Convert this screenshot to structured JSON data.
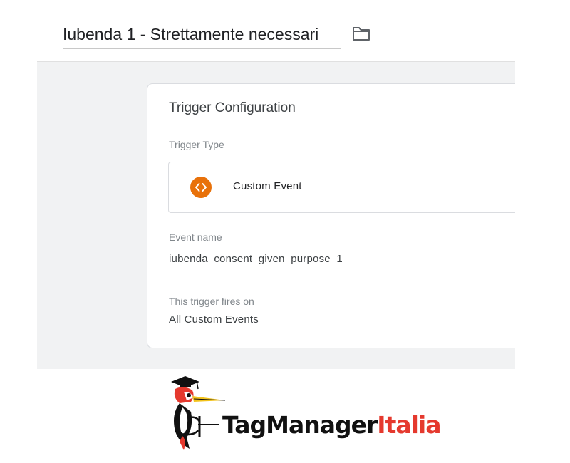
{
  "header": {
    "title_value": "Iubenda 1 - Strettamente necessari",
    "folder_icon": "folder-icon"
  },
  "trigger_config": {
    "heading": "Trigger Configuration",
    "trigger_type_label": "Trigger Type",
    "trigger_type": {
      "name": "Custom Event",
      "icon": "code-brackets-icon",
      "icon_color": "#e8710a"
    },
    "event_name_label": "Event name",
    "event_name_value": "iubenda_consent_given_purpose_1",
    "fires_on_label": "This trigger fires on",
    "fires_on_value": "All Custom Events"
  },
  "brand": {
    "logo_text_part1": "TagManager",
    "logo_text_part2": "Italia",
    "accent_color": "#e5392e"
  }
}
